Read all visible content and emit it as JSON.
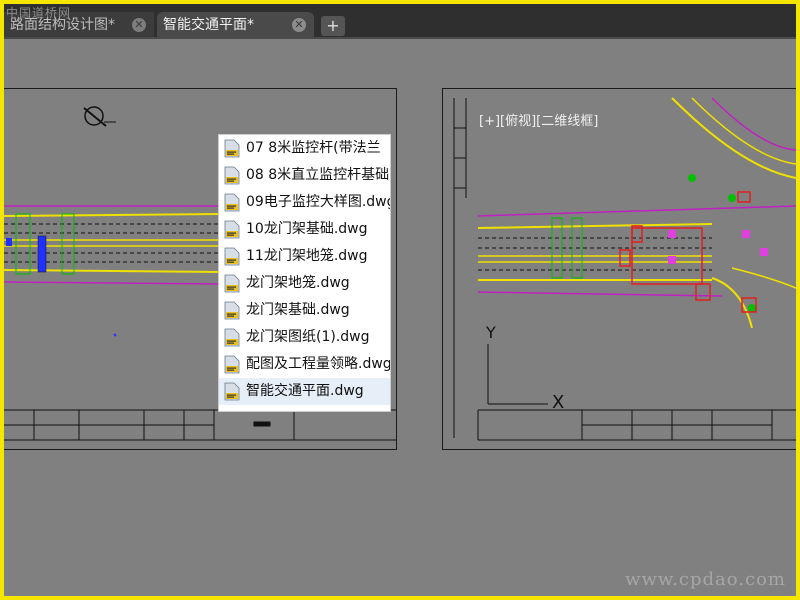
{
  "watermarks": {
    "top_left": "中国道桥网",
    "bottom_right": "www.cpdao.com"
  },
  "tabs": [
    {
      "label": "路面结构设计图*",
      "active": false
    },
    {
      "label": "智能交通平面*",
      "active": true
    }
  ],
  "new_tab_label": "+",
  "close_glyph": "✕",
  "viewport_label": "[+][俯视][二维线框]",
  "ucs": {
    "y": "Y",
    "x": "X"
  },
  "file_list": [
    {
      "name": "07 8米监控杆(带法兰",
      "icon": "dwg-file-icon"
    },
    {
      "name": "08 8米直立监控杆基础",
      "icon": "dwg-file-icon"
    },
    {
      "name": "09电子监控大样图.dwg",
      "icon": "dwg-file-icon"
    },
    {
      "name": "10龙门架基础.dwg",
      "icon": "dwg-file-icon"
    },
    {
      "name": "11龙门架地笼.dwg",
      "icon": "dwg-file-icon"
    },
    {
      "name": "龙门架地笼.dwg",
      "icon": "dwg-file-icon"
    },
    {
      "name": "龙门架基础.dwg",
      "icon": "dwg-file-icon"
    },
    {
      "name": "龙门架图纸(1).dwg",
      "icon": "dwg-file-icon"
    },
    {
      "name": "配图及工程量领略.dwg",
      "icon": "dwg-file-icon"
    },
    {
      "name": "智能交通平面.dwg",
      "icon": "dwg-file-icon",
      "selected": true
    }
  ],
  "colors": {
    "background": "#808080",
    "frame": "#f5e600",
    "road_yellow": "#f0e000",
    "road_magenta": "#c020c0",
    "road_green": "#00c000",
    "signal_red": "#e02020"
  }
}
